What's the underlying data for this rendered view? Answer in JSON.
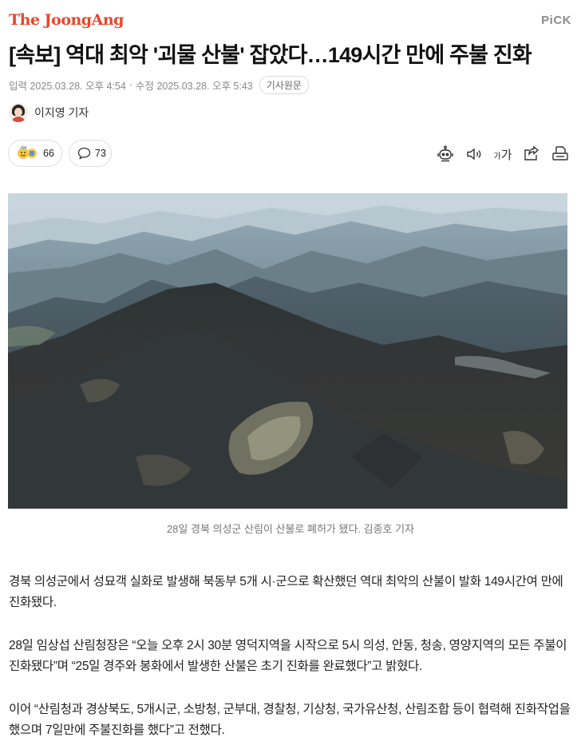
{
  "header": {
    "logo_text": "The JoongAng",
    "pick_label": "PiCK"
  },
  "article": {
    "headline": "[속보] 역대 최악 '괴물 산불' 잡았다…149시간 만에 주불 진화",
    "published": "입력 2025.03.28. 오후 4:54",
    "modified": "수정 2025.03.28. 오후 5:43",
    "origin_button": "기사원문",
    "reporter": "이지영 기자",
    "reaction_count": "66",
    "comment_count": "73",
    "font_size_label": "가",
    "photo_caption": "28일 경북 의성군 산림이 산불로 폐허가 됐다. 김종호 기자",
    "paragraphs": [
      "경북 의성군에서 성묘객 실화로 발생해 북동부 5개 시·군으로 확산했던 역대 최악의 산불이 발화 149시간여 만에 진화됐다.",
      "28일 임상섭 산림청장은 “오늘 오후 2시 30분 영덕지역을 시작으로 5시 의성, 안동, 청송, 영양지역의 모든 주불이 진화됐다”며 “25일 경주와 봉화에서 발생한 산불은 초기 진화를 완료했다”고 밝혔다.",
      "이어 “산림청과 경상북도, 5개시군, 소방청, 군부대, 경찰청, 기상청, 국가유산청, 산림조합 등이 협력해 진화작업을 했으며 7일만에 주불진화를 했다”고 전했다."
    ]
  },
  "icons": {
    "reaction": "reaction-emoji-icon",
    "comment": "comment-bubble-icon",
    "summary": "ai-summary-robot-icon",
    "audio": "speaker-icon",
    "font": "font-size-icon",
    "share": "share-icon",
    "print": "print-icon"
  },
  "colors": {
    "brand": "#e8462b",
    "meta_text": "#8a8a8a",
    "body_text": "#222222"
  }
}
